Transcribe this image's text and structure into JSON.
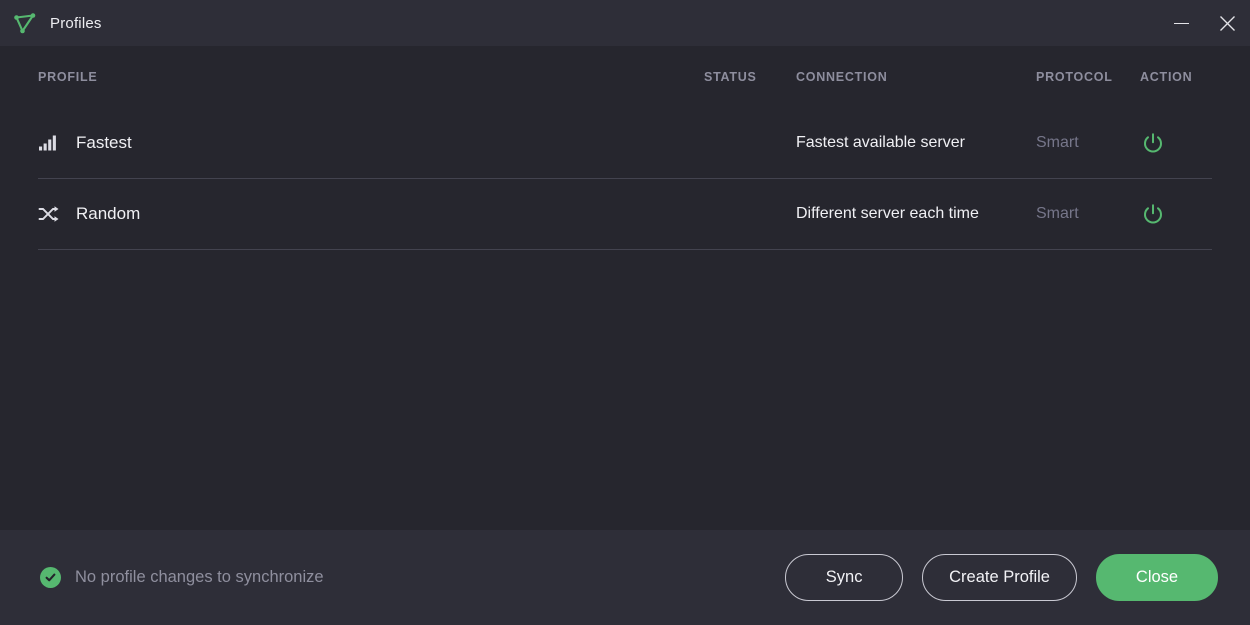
{
  "window": {
    "title": "Profiles",
    "logo_icon": "nordvpn-triangle-logo",
    "minimize_label": "Minimize",
    "close_label": "Close window",
    "minimize_icon": "minimize-icon",
    "close_icon": "close-x-icon"
  },
  "colors": {
    "titlebar_bg": "#2e2e38",
    "body_bg": "#26262e",
    "footer_bg": "#2e2e38",
    "accent_green": "#56b870",
    "header_text": "#8e8e9e",
    "muted_text": "#76768a",
    "divider": "#43434f"
  },
  "table": {
    "columns": [
      {
        "key": "profile",
        "label": "PROFILE"
      },
      {
        "key": "status",
        "label": "STATUS"
      },
      {
        "key": "connection",
        "label": "CONNECTION"
      },
      {
        "key": "protocol",
        "label": "PROTOCOL"
      },
      {
        "key": "action",
        "label": "ACTION"
      }
    ],
    "rows": [
      {
        "icon": "signal-bars-icon",
        "name": "Fastest",
        "status": "",
        "connection": "Fastest available server",
        "protocol": "Smart",
        "action_icon": "power-icon"
      },
      {
        "icon": "shuffle-icon",
        "name": "Random",
        "status": "",
        "connection": "Different server each time",
        "protocol": "Smart",
        "action_icon": "power-icon"
      }
    ]
  },
  "footer": {
    "sync_status_icon": "check-circle-icon",
    "sync_status_text": "No profile changes to synchronize",
    "buttons": {
      "sync": "Sync",
      "create_profile": "Create Profile",
      "close": "Close"
    }
  }
}
